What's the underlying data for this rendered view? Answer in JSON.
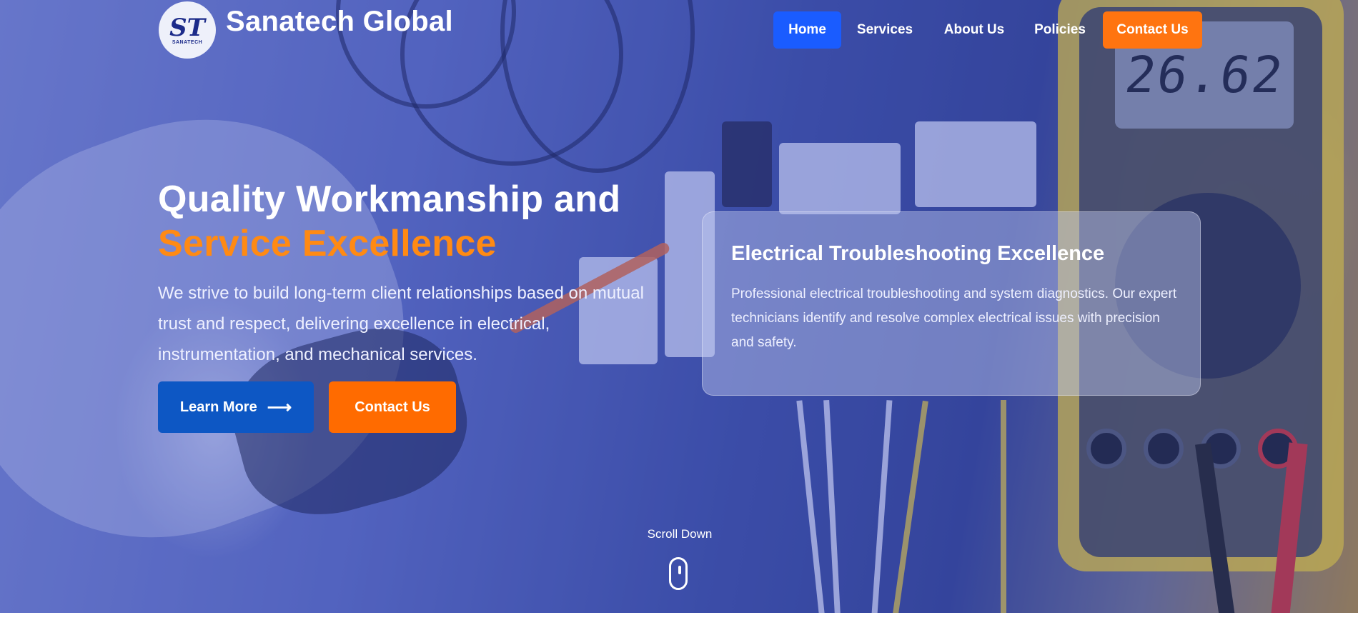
{
  "brand": {
    "name": "Sanatech Global",
    "logo_mark": "ST",
    "logo_sub": "SANATECH"
  },
  "nav": {
    "items": [
      {
        "label": "Home",
        "active": true
      },
      {
        "label": "Services",
        "active": false
      },
      {
        "label": "About Us",
        "active": false
      },
      {
        "label": "Policies",
        "active": false
      }
    ],
    "cta_label": "Contact Us"
  },
  "hero": {
    "title_line1": "Quality Workmanship and",
    "title_line2": "Service Excellence",
    "description": "We strive to build long-term client relationships based on mutual trust and respect, delivering excellence in electrical, instrumentation, and mechanical services.",
    "learn_more_label": "Learn More",
    "learn_more_icon": "arrow-right-icon",
    "contact_label": "Contact Us"
  },
  "card": {
    "title": "Electrical Troubleshooting Excellence",
    "text": "Professional electrical troubleshooting and system diagnostics. Our expert technicians identify and resolve complex electrical issues with precision and safety."
  },
  "scroll": {
    "label": "Scroll Down",
    "icon": "mouse-icon"
  },
  "background": {
    "meter_reading": "26.62"
  },
  "colors": {
    "primary_blue": "#1a5cff",
    "button_blue": "#0d57c4",
    "accent_orange": "#ff7410",
    "title_orange": "#ff8a14"
  }
}
